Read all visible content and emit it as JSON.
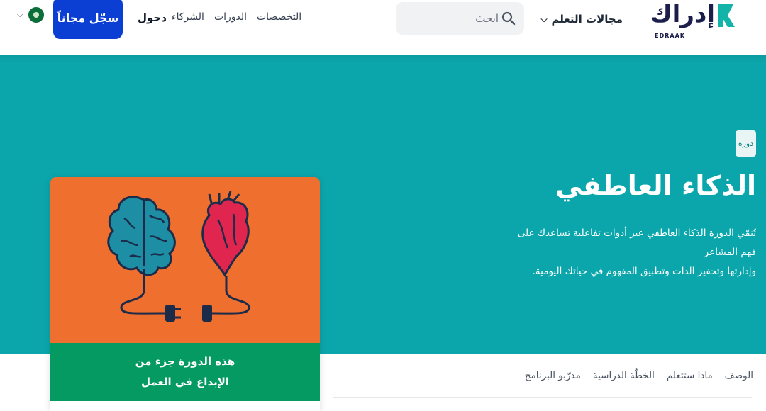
{
  "header": {
    "logo": {
      "text_ar": "إدراك",
      "text_en": "EDRAAK"
    },
    "learning_menu_label": "مجالات التعلم",
    "search": {
      "placeholder": "ابحث",
      "value": ""
    },
    "nav": [
      {
        "label": "التخصصات"
      },
      {
        "label": "الدورات"
      },
      {
        "label": "الشركاء"
      }
    ],
    "login_label": "دخول",
    "signup_label": "سجّل مجاناً",
    "language_icon": "flag-icon"
  },
  "hero": {
    "badge": "دورة",
    "title": "الذكاء العاطفي",
    "description_line1": "تُنمّي الدورة الذكاء العاطفي عبر أدوات تفاعلية تساعدك على فهم المشاعر",
    "description_line2": "وإدارتها وتحفيز الذات وتطبيق المفهوم في حياتك اليومية.",
    "background_color": "#0ba6ab"
  },
  "card": {
    "image_icon": "brain-heart-plug-illustration",
    "image_bg": "#ef6f2e",
    "band_line1": "هذه الدورة جزء من",
    "band_line2": "الإبداع في العمل",
    "band_color": "#069a63"
  },
  "tabs": [
    {
      "label": "الوصف"
    },
    {
      "label": "ماذا ستتعلم"
    },
    {
      "label": "الخطّة الدراسية"
    },
    {
      "label": "مدرّبو البرنامج"
    }
  ],
  "colors": {
    "primary_button": "#0b3fd4",
    "logo_navy": "#1b1d4a",
    "logo_teal": "#12b3a8"
  }
}
